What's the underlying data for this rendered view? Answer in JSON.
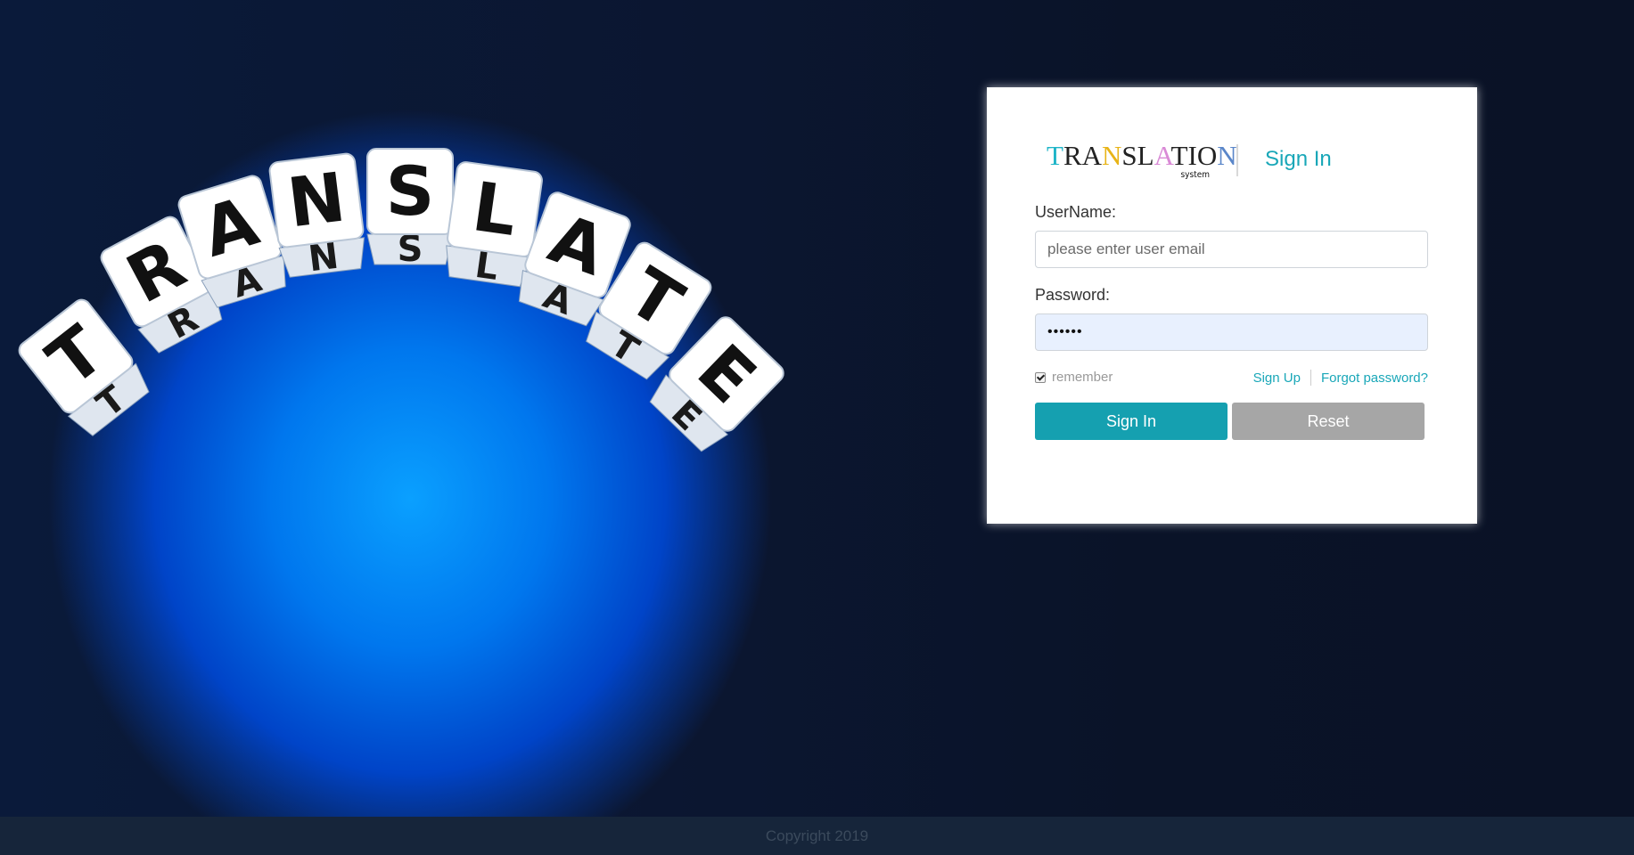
{
  "hero": {
    "dice_letters": [
      "T",
      "R",
      "A",
      "N",
      "S",
      "L",
      "A",
      "T",
      "E"
    ]
  },
  "brand": {
    "logo_letters": [
      {
        "ch": "T",
        "color": "#1fb5c8"
      },
      {
        "ch": "R",
        "color": "#222222"
      },
      {
        "ch": "A",
        "color": "#222222"
      },
      {
        "ch": "N",
        "color": "#e8b417"
      },
      {
        "ch": "S",
        "color": "#222222"
      },
      {
        "ch": "L",
        "color": "#222222"
      },
      {
        "ch": "A",
        "color": "#d98ad6"
      },
      {
        "ch": "T",
        "color": "#222222"
      },
      {
        "ch": "I",
        "color": "#222222"
      },
      {
        "ch": "O",
        "color": "#222222"
      },
      {
        "ch": "N",
        "color": "#5a86c9"
      }
    ],
    "logo_subtitle": "system"
  },
  "login": {
    "title": "Sign In",
    "username_label": "UserName:",
    "username_placeholder": "please enter user email",
    "username_value": "",
    "password_label": "Password:",
    "password_value": "••••••",
    "remember_label": "remember",
    "remember_checked": true,
    "signup_link": "Sign Up",
    "forgot_link": "Forgot password?",
    "signin_button": "Sign In",
    "reset_button": "Reset"
  },
  "footer": {
    "copyright": "Copyright 2019"
  },
  "colors": {
    "accent": "#19a7b8",
    "primary_button": "#15a0b0",
    "reset_button": "#a6a6a6",
    "page_background": "#0a1326",
    "footer_background": "#16253a"
  }
}
